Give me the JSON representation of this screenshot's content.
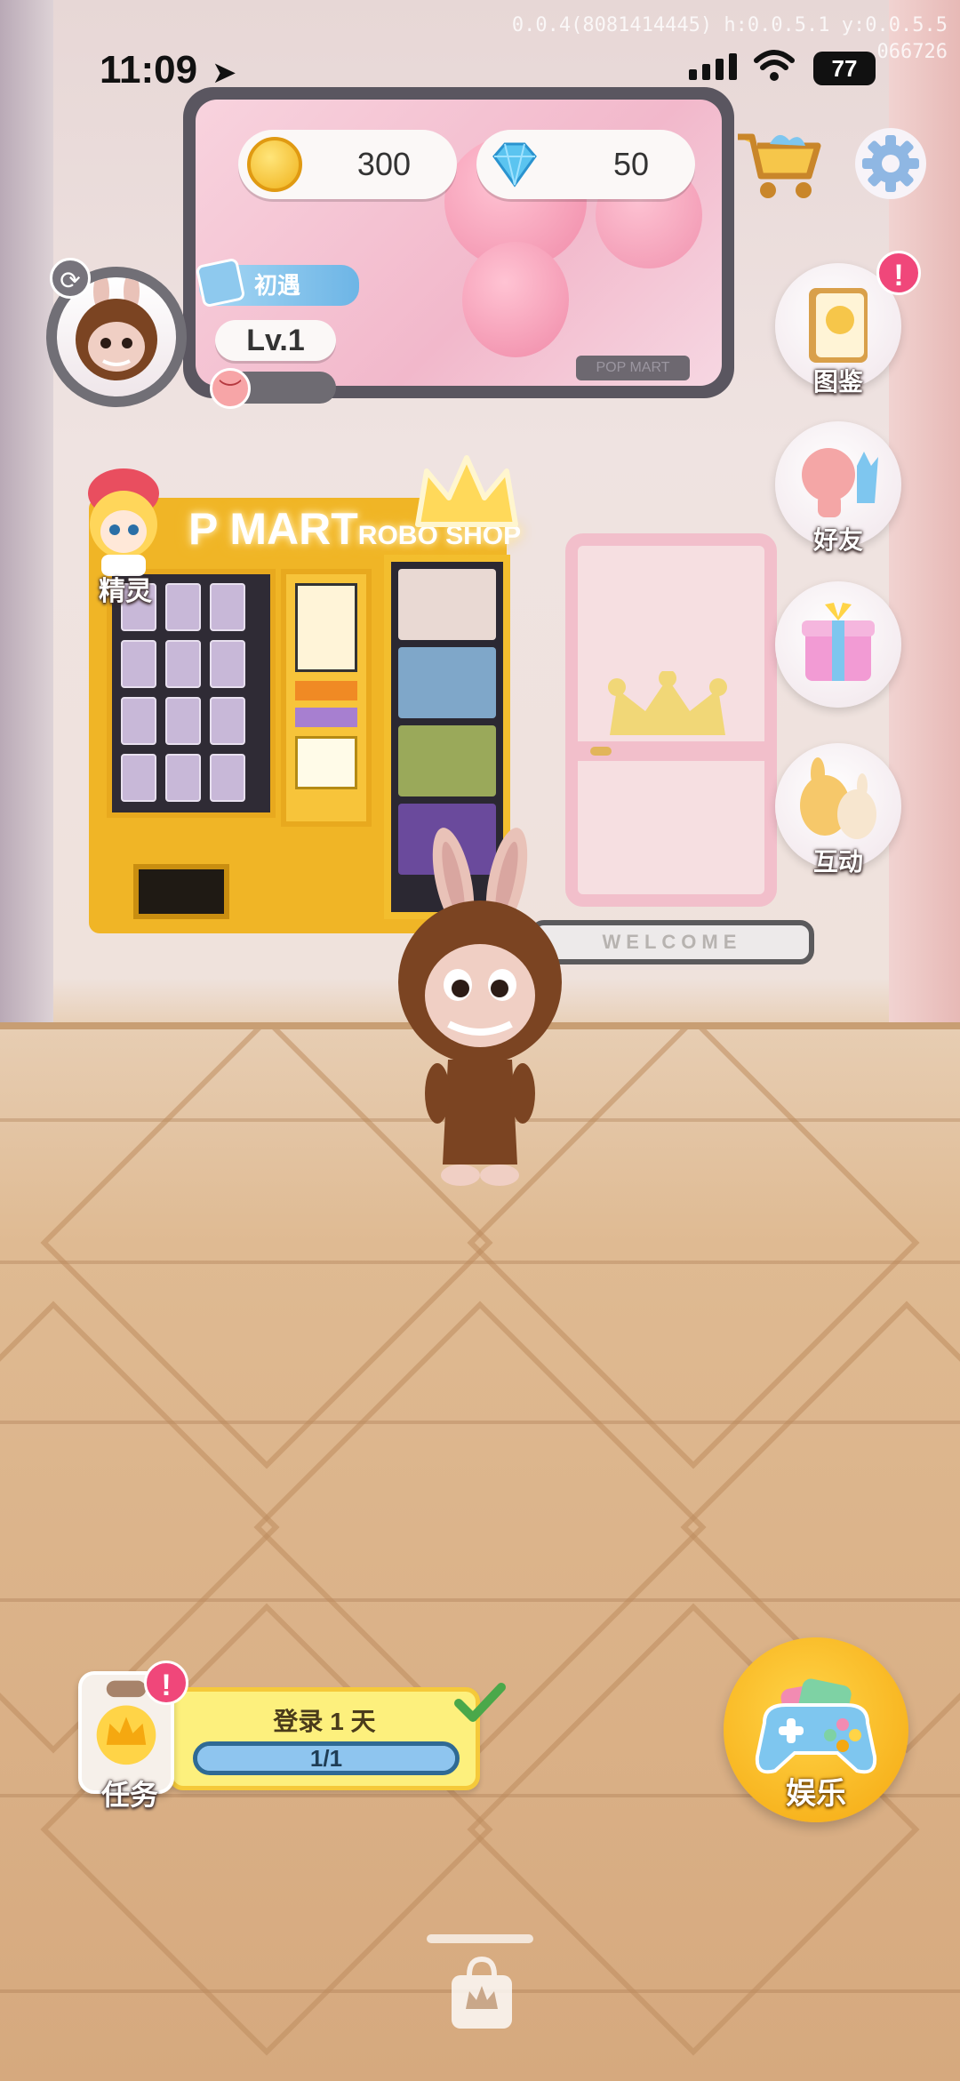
{
  "status_bar": {
    "time": "11:09",
    "battery": "77",
    "debug_line1": "0.0.4(8081414445) h:0.0.5.1 y:0.0.5.5",
    "debug_line2": "066726"
  },
  "top_bar": {
    "coins": "300",
    "gems": "50",
    "banner_tag": "POP MART"
  },
  "profile": {
    "badge": "初遇",
    "level": "Lv.1"
  },
  "side_menu": [
    {
      "label": "图鉴",
      "icon": "book-icon",
      "alert": "!"
    },
    {
      "label": "好友",
      "icon": "friends-icon"
    },
    {
      "label": "",
      "icon": "gift-icon"
    },
    {
      "label": "互动",
      "icon": "interact-icon"
    }
  ],
  "scene": {
    "shop_sign": "MART",
    "shop_sign_sub": "ROBO SHOP",
    "shop_sign_prefix": "P",
    "mat_text": "WELCOME",
    "elf_label": "精灵"
  },
  "task": {
    "label": "任务",
    "alert": "!",
    "title": "登录 1 天",
    "progress_text": "1/1",
    "progress": 1.0
  },
  "game": {
    "label": "娱乐"
  },
  "icons": {
    "coin": "coin-icon",
    "gem": "gem-icon",
    "cart": "cart-icon",
    "settings": "gear-icon",
    "bag": "bag-icon"
  },
  "colors": {
    "accent_yellow": "#f5a810",
    "alert_pink": "#f0477a",
    "task_bar": "#8ec5ef"
  }
}
